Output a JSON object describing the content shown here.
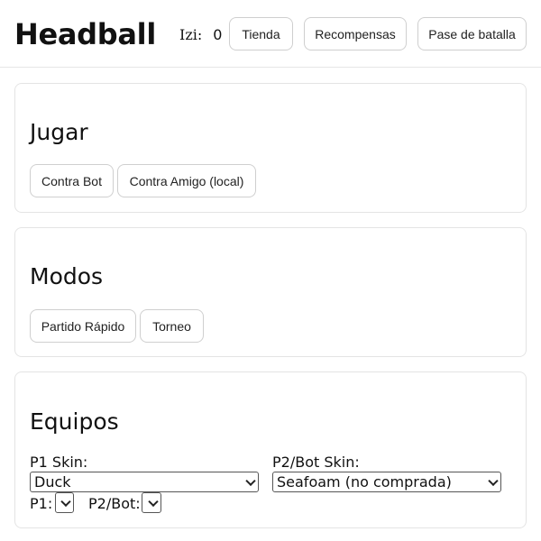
{
  "header": {
    "title": "Headball",
    "currency_label": "Izi:",
    "currency_value": "0",
    "shop_label": "Tienda",
    "rewards_label": "Recompensas",
    "battle_pass_label": "Pase de batalla"
  },
  "play": {
    "title": "Jugar",
    "vs_bot_label": "Contra Bot",
    "vs_friend_label": "Contra Amigo (local)"
  },
  "modes": {
    "title": "Modos",
    "quick_match_label": "Partido Rápido",
    "tournament_label": "Torneo"
  },
  "teams": {
    "title": "Equipos",
    "p1_skin_label": "P1 Skin:",
    "p1_skin_value": "Duck",
    "p2_skin_label": "P2/Bot Skin:",
    "p2_skin_value": "Seafoam (no comprada)",
    "p1_label": "P1:",
    "p1_value": "",
    "p2_label": "P2/Bot:",
    "p2_value": ""
  }
}
